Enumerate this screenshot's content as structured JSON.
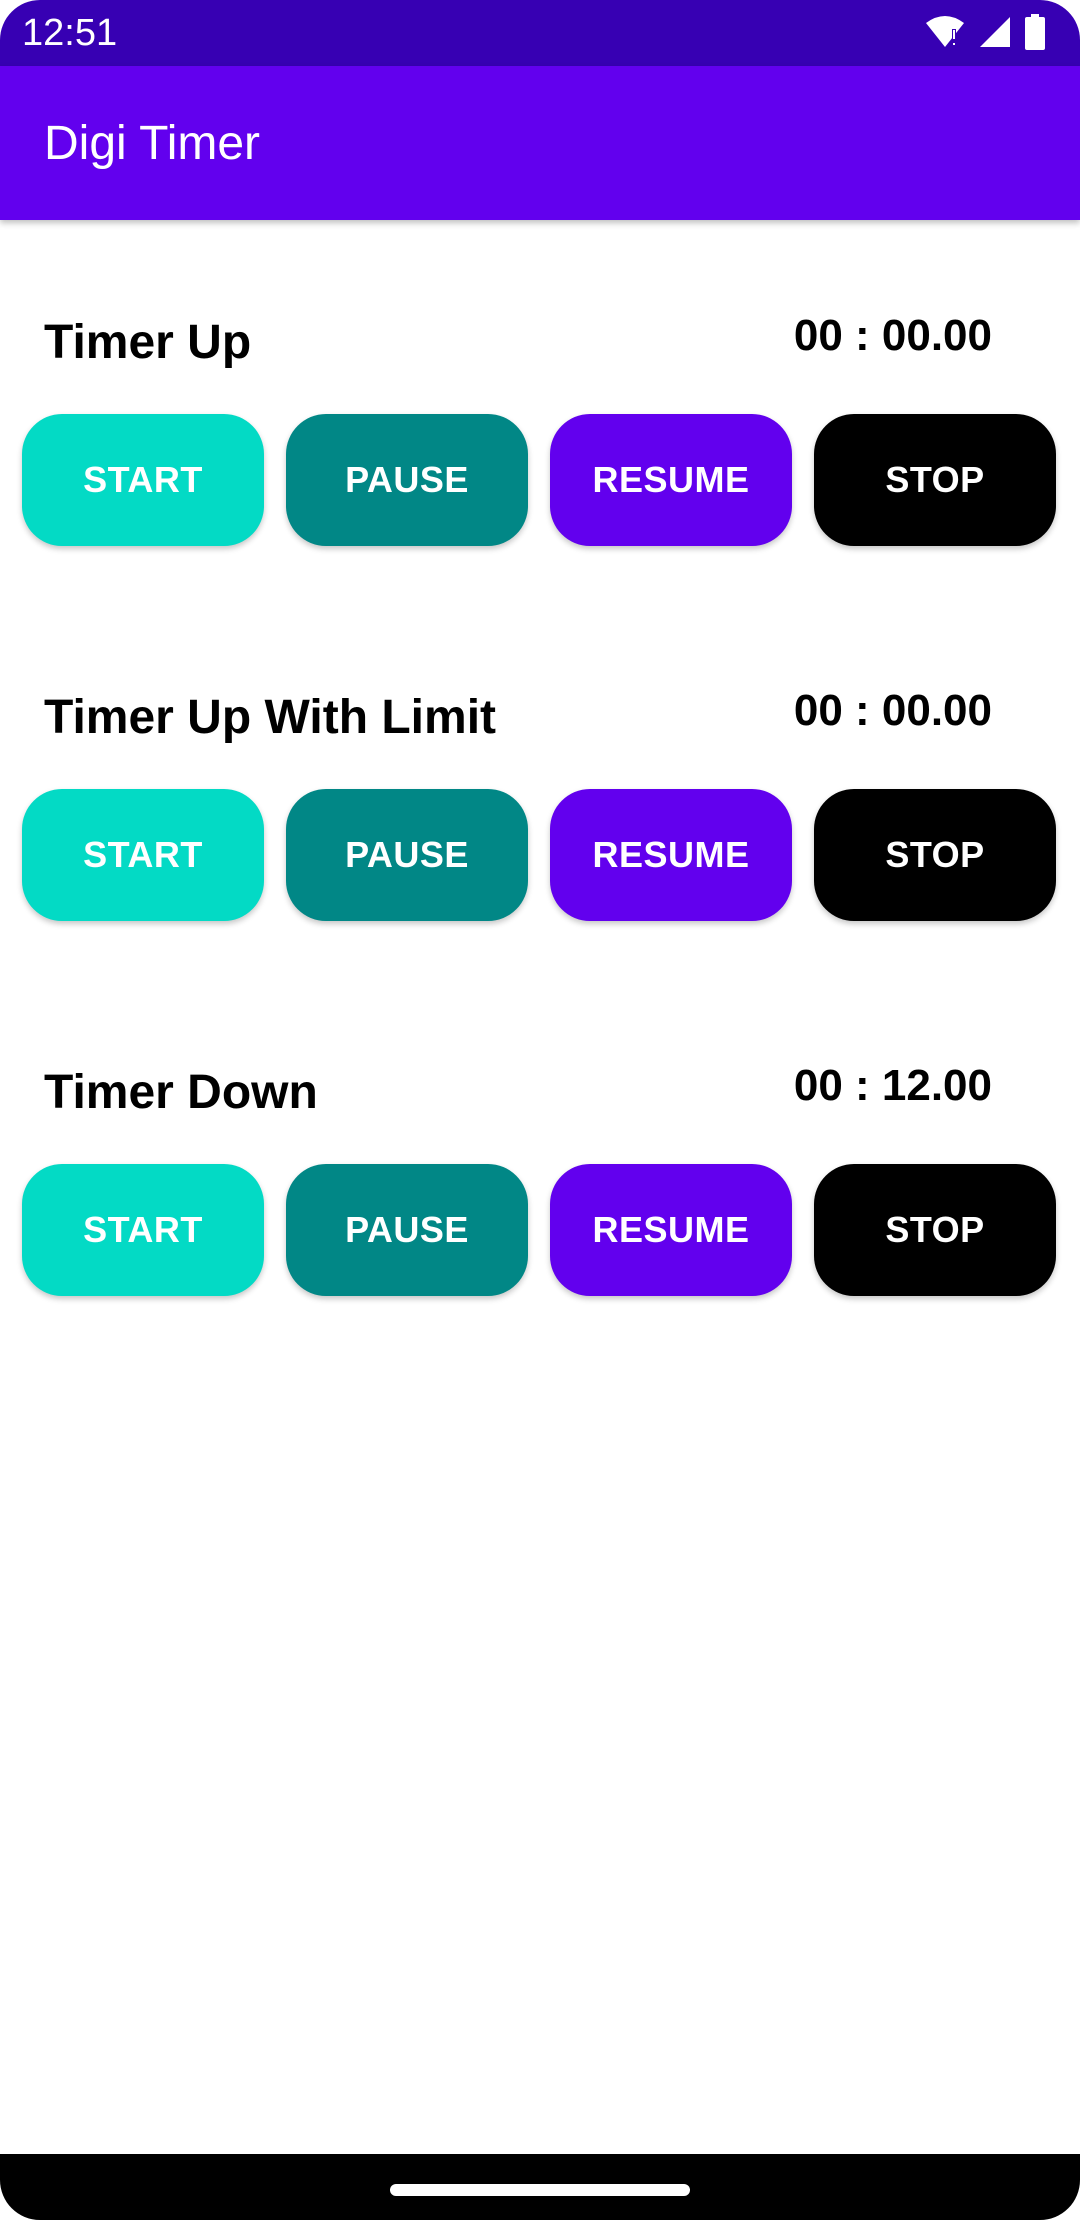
{
  "status_bar": {
    "time": "12:51",
    "icons": [
      "wifi-alert-icon",
      "cellular-signal-icon",
      "battery-icon"
    ]
  },
  "app_bar": {
    "title": "Digi Timer"
  },
  "timers": [
    {
      "label": "Timer Up",
      "value": "00 : 00.00",
      "buttons": {
        "start": "START",
        "pause": "PAUSE",
        "resume": "RESUME",
        "stop": "STOP"
      }
    },
    {
      "label": "Timer Up With Limit",
      "value": "00 : 00.00",
      "buttons": {
        "start": "START",
        "pause": "PAUSE",
        "resume": "RESUME",
        "stop": "STOP"
      }
    },
    {
      "label": "Timer Down",
      "value": "00 : 12.00",
      "buttons": {
        "start": "START",
        "pause": "PAUSE",
        "resume": "RESUME",
        "stop": "STOP"
      }
    }
  ],
  "colors": {
    "status_bar": "#3700b3",
    "app_bar": "#6200ee",
    "start": "#03dac5",
    "pause": "#018786",
    "resume": "#6200ee",
    "stop": "#000000"
  }
}
